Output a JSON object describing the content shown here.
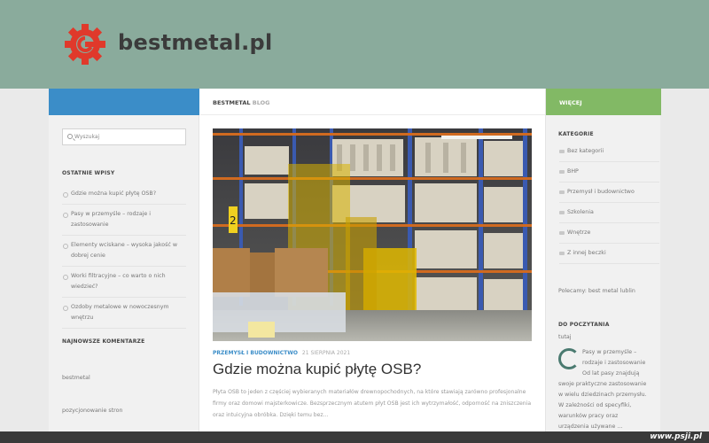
{
  "header": {
    "site_name": "bestmetal.pl",
    "colors": {
      "header_bg": "#8aab9c",
      "logo": "#e0392b",
      "left_accent": "#3b8dc8",
      "right_accent": "#82b965"
    }
  },
  "left_sidebar": {
    "search_placeholder": "Wyszukaj",
    "recent_title": "OSTATNIE WPISY",
    "recent": [
      "Gdzie można kupić płytę OSB?",
      "Pasy w przemyśle – rodzaje i zastosowanie",
      "Elementy wciskane – wysoka jakość w dobrej cenie",
      "Worki filtracyjne – co warto o nich wiedzieć?",
      "Ozdoby metalowe w nowoczesnym wnętrzu"
    ],
    "comments_title": "NAJNOWSZE KOMENTARZE",
    "comments": [
      "bestmetal",
      "pozycjonowanie stron"
    ]
  },
  "content": {
    "section_title_1": "BESTMETAL",
    "section_title_2": "BLOG",
    "post": {
      "category": "PRZEMYSŁ I BUDOWNICTWO",
      "date": "21 SIERPNIA 2021",
      "title": "Gdzie można kupić płytę OSB?",
      "excerpt": "Płyta OSB to jeden z częściej wybieranych materiałów drewnopochodnych, na które stawiają zarówno profesjonalne firmy oraz domowi majsterkowicze. Bezsprzecznym atutem płyt OSB jest ich wytrzymałość, odporność na zniszczenia oraz intuicyjna obróbka. Dzięki temu bez..."
    }
  },
  "right_sidebar": {
    "header": "WIĘCEJ",
    "categories_title": "KATEGORIE",
    "categories": [
      "Bez kategorii",
      "BHP",
      "Przemysł i budownictwo",
      "Szkolenia",
      "Wnętrze",
      "Z innej beczki"
    ],
    "recommend": "Polecamy: best metal lublin",
    "read_title": "DO POCZYTANIA",
    "read_author": "tutaj",
    "read_text": "Pasy w przemyśle – rodzaje i zastosowanie Od lat pasy znajdują swoje praktyczne zastosowanie w wielu dziedzinach przemysłu. W zależności od specyfiki, warunków pracy oraz urządzenia używane ..."
  },
  "watermark": "www.psji.pl"
}
